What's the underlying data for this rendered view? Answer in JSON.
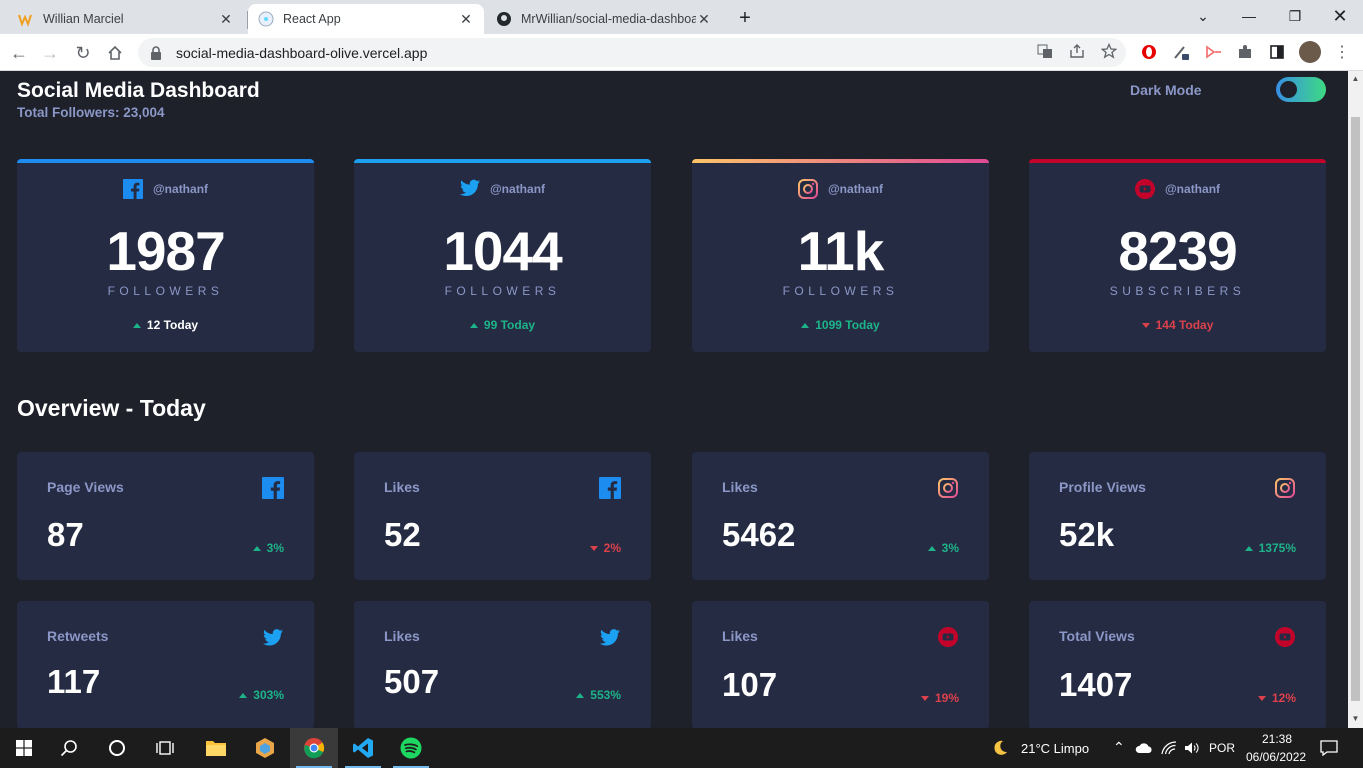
{
  "browser": {
    "tabs": [
      {
        "title": "Willian Marciel",
        "icon": "wm-logo-icon",
        "active": false
      },
      {
        "title": "React App",
        "icon": "react-icon",
        "active": true
      },
      {
        "title": "MrWillian/social-media-dashboa",
        "icon": "github-icon",
        "active": false
      }
    ],
    "url": "social-media-dashboard-olive.vercel.app"
  },
  "header": {
    "title": "Social Media Dashboard",
    "total_followers": "Total Followers: 23,004",
    "dark_mode_label": "Dark Mode",
    "dark_mode_on": true
  },
  "followers": [
    {
      "network": "facebook",
      "handle": "@nathanf",
      "count": "1987",
      "unit": "FOLLOWERS",
      "delta": "12 Today",
      "trend": "up",
      "bar": "#1d8cf0"
    },
    {
      "network": "twitter",
      "handle": "@nathanf",
      "count": "1044",
      "unit": "FOLLOWERS",
      "delta": "99 Today",
      "trend": "up",
      "bar": "#1ca0f2"
    },
    {
      "network": "instagram",
      "handle": "@nathanf",
      "count": "11k",
      "unit": "FOLLOWERS",
      "delta": "1099 Today",
      "trend": "up",
      "bar": "linear-gradient(90deg,#fdc468,#df4996)"
    },
    {
      "network": "youtube",
      "handle": "@nathanf",
      "count": "8239",
      "unit": "SUBSCRIBERS",
      "delta": "144 Today",
      "trend": "down",
      "bar": "#c4032a"
    }
  ],
  "overview": {
    "title": "Overview - Today",
    "cards": [
      {
        "label": "Page Views",
        "network": "facebook",
        "value": "87",
        "delta": "3%",
        "trend": "up"
      },
      {
        "label": "Likes",
        "network": "facebook",
        "value": "52",
        "delta": "2%",
        "trend": "down"
      },
      {
        "label": "Likes",
        "network": "instagram",
        "value": "5462",
        "delta": "3%",
        "trend": "up"
      },
      {
        "label": "Profile Views",
        "network": "instagram",
        "value": "52k",
        "delta": "1375%",
        "trend": "up"
      },
      {
        "label": "Retweets",
        "network": "twitter",
        "value": "117",
        "delta": "303%",
        "trend": "up"
      },
      {
        "label": "Likes",
        "network": "twitter",
        "value": "507",
        "delta": "553%",
        "trend": "up"
      },
      {
        "label": "Likes",
        "network": "youtube",
        "value": "107",
        "delta": "19%",
        "trend": "down"
      },
      {
        "label": "Total Views",
        "network": "youtube",
        "value": "1407",
        "delta": "12%",
        "trend": "down"
      }
    ]
  },
  "colors": {
    "background": "#1e202a",
    "card": "#252b43",
    "muted_text": "#8b97c6",
    "up": "#1db489",
    "down": "#dc414c"
  },
  "taskbar": {
    "weather": "21°C  Limpo",
    "language": "POR",
    "time": "21:38",
    "date": "06/06/2022"
  }
}
